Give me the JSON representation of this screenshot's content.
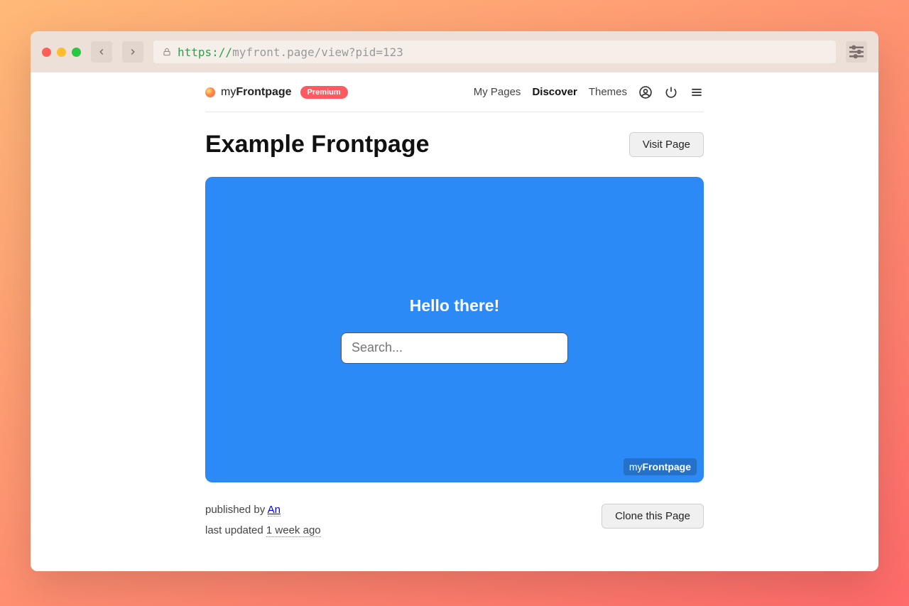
{
  "browser": {
    "url_protocol": "https://",
    "url_rest": "myfront.page/view?pid=123"
  },
  "brand": {
    "prefix": "my",
    "name": "Frontpage",
    "badge": "Premium"
  },
  "nav": {
    "my_pages": "My Pages",
    "discover": "Discover",
    "themes": "Themes"
  },
  "page": {
    "title": "Example Frontpage",
    "visit_button": "Visit Page",
    "clone_button": "Clone this Page"
  },
  "preview": {
    "heading": "Hello there!",
    "search_placeholder": "Search...",
    "watermark_prefix": "my",
    "watermark_name": "Frontpage"
  },
  "meta": {
    "published_prefix": "published by ",
    "published_author": "An",
    "updated_prefix": "last updated ",
    "updated_time": "1 week ago"
  }
}
